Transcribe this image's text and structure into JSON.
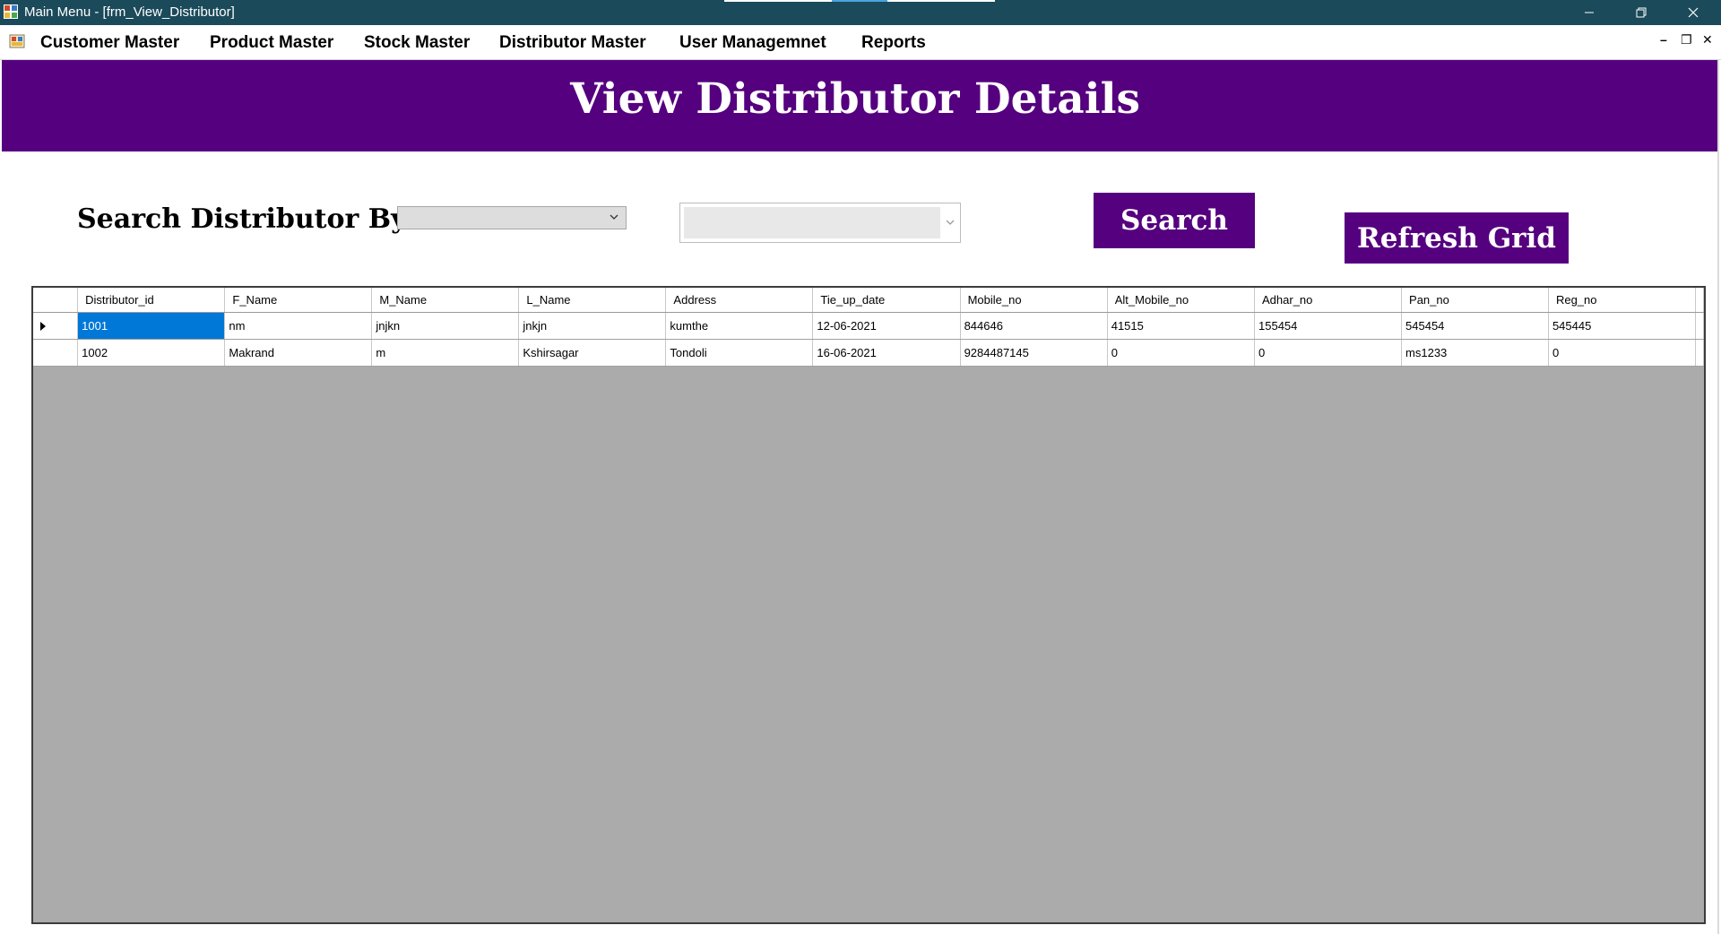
{
  "window": {
    "title": "Main Menu - [frm_View_Distributor]",
    "minimize_glyph": "—",
    "restore_glyph": "❐",
    "close_glyph": "✕"
  },
  "menu": {
    "items": [
      {
        "label": "Customer Master"
      },
      {
        "label": "Product Master"
      },
      {
        "label": "Stock Master"
      },
      {
        "label": "Distributor Master"
      },
      {
        "label": "User Managemnet"
      },
      {
        "label": "Reports"
      }
    ],
    "mdi_minimize": "–",
    "mdi_restore": "❐",
    "mdi_close": "✕"
  },
  "header": {
    "title": "View Distributor Details",
    "band_color": "#55007f"
  },
  "search": {
    "label": "Search Distributor By",
    "field_selected": "",
    "value_selected": "",
    "search_button": "Search",
    "refresh_button": "Refresh Grid"
  },
  "grid": {
    "columns": [
      "Distributor_id",
      "F_Name",
      "M_Name",
      "L_Name",
      "Address",
      "Tie_up_date",
      "Mobile_no",
      "Alt_Mobile_no",
      "Adhar_no",
      "Pan_no",
      "Reg_no"
    ],
    "rows": [
      [
        "1001",
        "nm",
        "jnjkn",
        "jnkjn",
        "kumthe",
        "12-06-2021",
        "844646",
        "41515",
        "155454",
        "545454",
        "545445"
      ],
      [
        "1002",
        "Makrand",
        "m",
        "Kshirsagar",
        "Tondoli",
        "16-06-2021",
        "9284487145",
        "0",
        "0",
        "ms1233",
        "0"
      ]
    ],
    "selected_row": 0,
    "selection_color": "#0078d7"
  }
}
